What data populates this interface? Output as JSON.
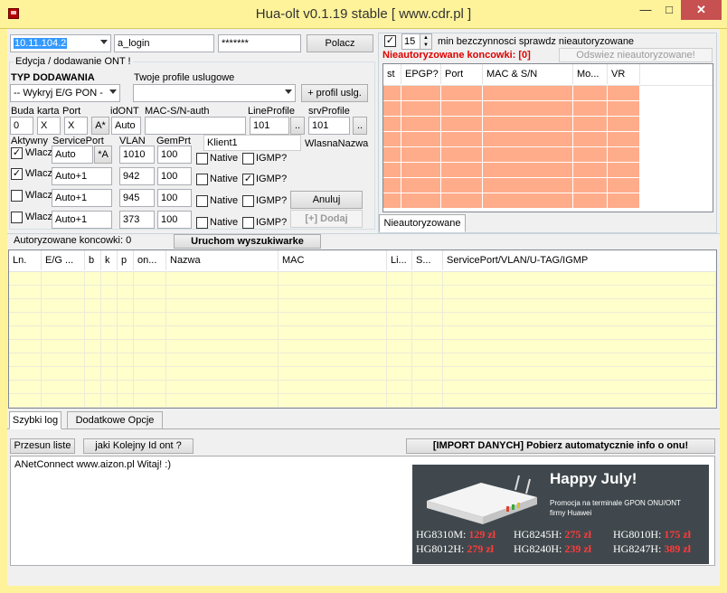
{
  "window": {
    "title": "Hua-olt v0.1.19 stable [ www.cdr.pl ]",
    "minimize": "—",
    "maximize": "□",
    "close": "✕"
  },
  "conn": {
    "ip": "10.11.104.2",
    "login": "a_login",
    "password": "*******",
    "connect": "Polacz"
  },
  "edit": {
    "group_title": "Edycja  / dodawanie ONT !",
    "type_label": "TYP DODAWANIA",
    "type_value": "-- Wykryj E/G PON -",
    "profiles_label": "Twoje profile uslugowe",
    "profiles_value": "",
    "add_profile": "+ profil uslg.",
    "labels": {
      "buda": "Buda",
      "karta": "karta",
      "port": "Port",
      "idont": "idONT",
      "mac": "MAC-S/N-auth",
      "lineprofile": "LineProfile",
      "srvprofile": "srvProfile"
    },
    "values": {
      "buda": "0",
      "karta": "X",
      "port": "X",
      "a_star": "A*",
      "idont": "Auto",
      "mac": "",
      "lineprofile": "101",
      "srvprofile": "101",
      "more": ".."
    },
    "col_labels": {
      "aktywny": "Aktywny",
      "serviceport": "ServicePort",
      "vlan": "VLAN",
      "gemprt": "GemPrt",
      "klient": "Klient1",
      "wlasna": "WlasnaNazwa"
    },
    "rows": [
      {
        "checked": true,
        "label": "Wlacz",
        "sp": "Auto",
        "sp_btn": "*A",
        "vlan": "1010",
        "gem": "100",
        "native": "Native",
        "native_checked": false,
        "igmp": "IGMP?",
        "igmp_checked": false
      },
      {
        "checked": true,
        "label": "Wlacz",
        "sp": "Auto+1",
        "vlan": "942",
        "gem": "100",
        "native": "Native",
        "native_checked": false,
        "igmp": "IGMP?",
        "igmp_checked": true
      },
      {
        "checked": false,
        "label": "Wlacz",
        "sp": "Auto+1",
        "vlan": "945",
        "gem": "100",
        "native": "Native",
        "native_checked": false,
        "igmp": "IGMP?",
        "igmp_checked": false
      },
      {
        "checked": false,
        "label": "Wlacz",
        "sp": "Auto+1",
        "vlan": "373",
        "gem": "100",
        "native": "Native",
        "native_checked": false,
        "igmp": "IGMP?",
        "igmp_checked": false
      }
    ],
    "cancel": "Anuluj",
    "add": "[+] Dodaj"
  },
  "unauth": {
    "check_mark": "✓",
    "minutes": "15",
    "check_label": "min bezczynnosci sprawdz nieautoryzowane",
    "count_label": "Nieautoryzowane koncowki: [0]",
    "refresh": "Odswiez nieautoryzowane!",
    "columns": [
      "st",
      "EPGP?",
      "Port",
      "MAC & S/N",
      "Mo...",
      "VR"
    ],
    "tab": "Nieautoryzowane",
    "color": "#ffac8a"
  },
  "auth": {
    "count_label": "Autoryzowane koncowki: 0",
    "search": "Uruchom wyszukiwarke",
    "columns": [
      "Ln.",
      "E/G ...",
      "b",
      "k",
      "p",
      "on...",
      "Nazwa",
      "MAC",
      "Li...",
      "S...",
      "ServicePort/VLAN/U-TAG/IGMP"
    ],
    "color": "#ffffcc"
  },
  "bottom": {
    "tabs": [
      "Szybki log",
      "Dodatkowe Opcje"
    ],
    "btn_list": "Przesun liste",
    "btn_next_id": "jaki Kolejny Id ont ?",
    "btn_import": "[IMPORT DANYCH] Pobierz automatycznie info o onu!",
    "log": "ANetConnect www.aizon.pl Witaj! :)"
  },
  "banner": {
    "headline": "Happy July!",
    "sub1": "Promocja na terminale GPON ONU/ONT",
    "sub2": "firmy Huawei",
    "prices": [
      {
        "model": "HG8310M:",
        "price": "129 zł"
      },
      {
        "model": "HG8245H:",
        "price": "275 zł"
      },
      {
        "model": "HG8010H:",
        "price": "175 zł"
      },
      {
        "model": "HG8012H:",
        "price": "279 zł"
      },
      {
        "model": "HG8240H:",
        "price": "239 zł"
      },
      {
        "model": "HG8247H:",
        "price": "389 zł"
      }
    ]
  }
}
